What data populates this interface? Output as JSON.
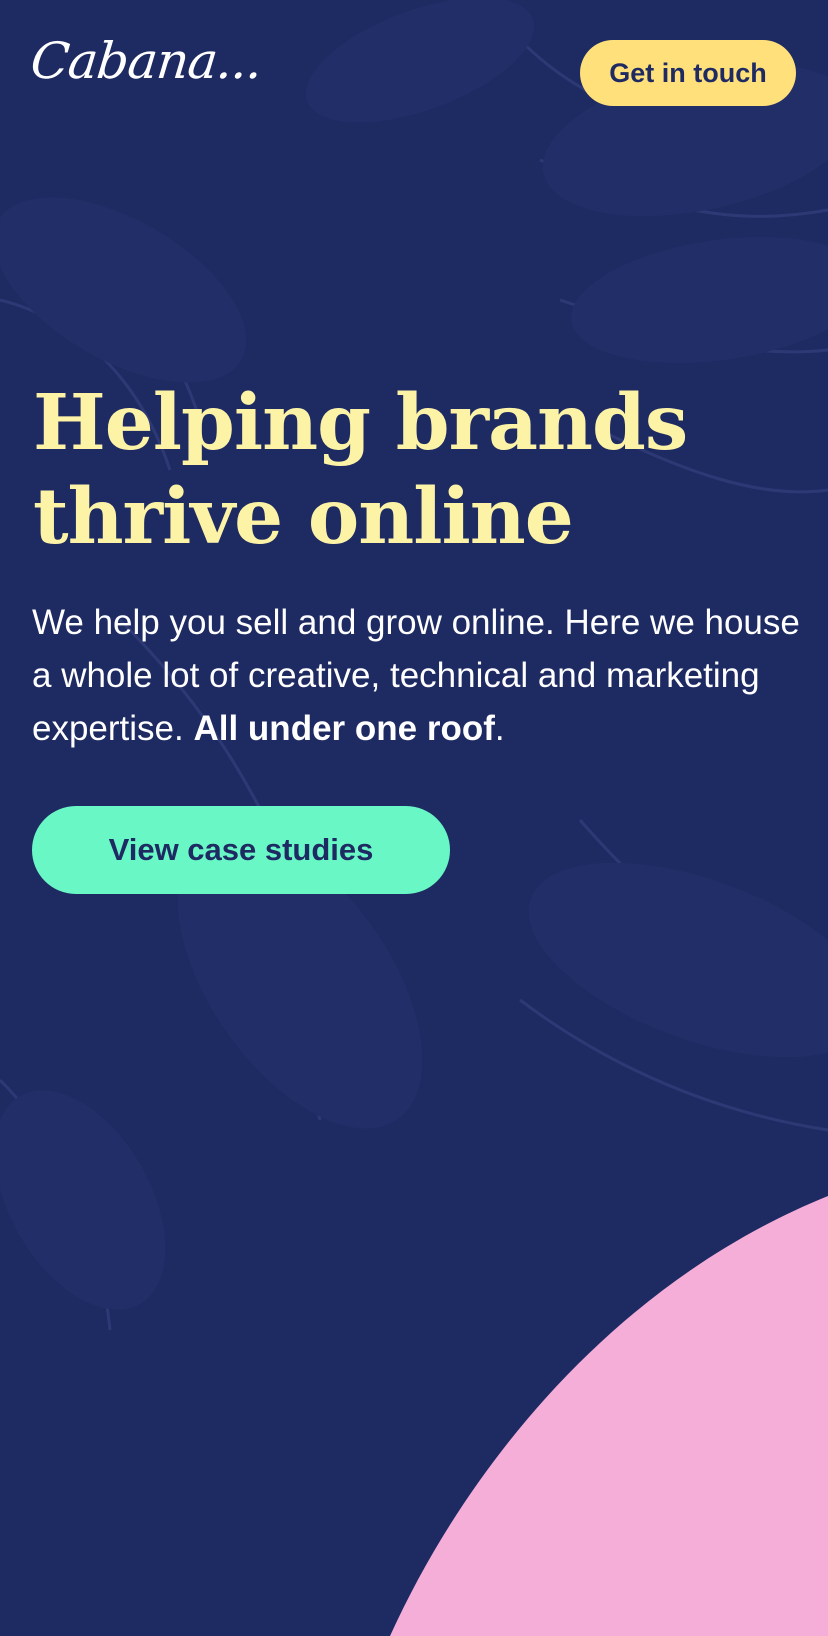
{
  "brand": {
    "logo_text": "Cabana..."
  },
  "header": {
    "cta_label": "Get in touch"
  },
  "hero": {
    "headline_line1": "Helping brands",
    "headline_line2": "thrive online",
    "subtext_lead": "We help you sell and grow online. Here we house a whole lot of creative, technical and marketing expertise.",
    "subtext_bold": "All under one roof",
    "subtext_tail": ".",
    "primary_cta_label": "View case studies"
  },
  "colors": {
    "background": "#1e2a62",
    "headline": "#fdf3a7",
    "top_cta": "#ffe07a",
    "primary_cta": "#6af7c6",
    "accent_blob": "#f5aed8"
  }
}
